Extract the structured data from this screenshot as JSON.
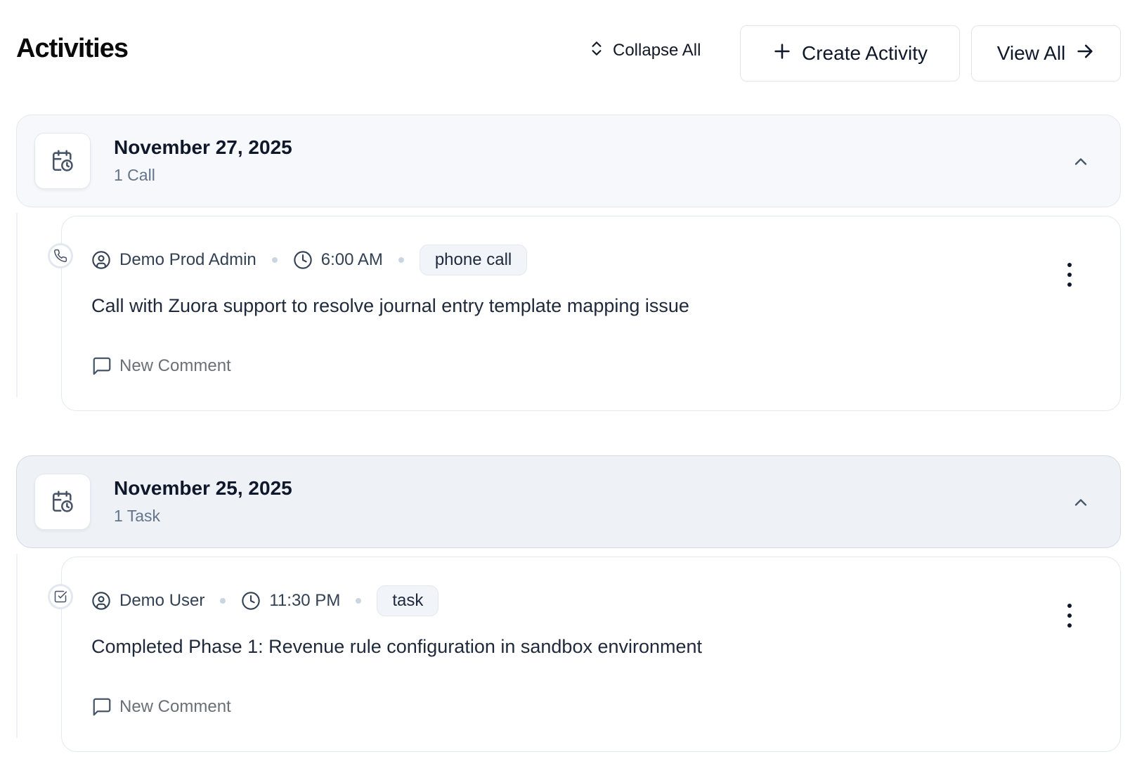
{
  "header": {
    "title": "Activities",
    "collapse_all": "Collapse All",
    "create_activity": "Create Activity",
    "view_all": "View All"
  },
  "groups": [
    {
      "date": "November 27, 2025",
      "count": "1 Call",
      "expanded": true,
      "activities": [
        {
          "type": "phone-call",
          "user": "Demo Prod Admin",
          "time": "6:00 AM",
          "tag": "phone call",
          "description": "Call with Zuora support to resolve journal entry template mapping issue",
          "comment_label": "New Comment"
        }
      ]
    },
    {
      "date": "November 25, 2025",
      "count": "1 Task",
      "expanded": true,
      "activities": [
        {
          "type": "task",
          "user": "Demo User",
          "time": "11:30 PM",
          "tag": "task",
          "description": "Completed Phase 1: Revenue rule configuration in sandbox environment",
          "comment_label": "New Comment"
        }
      ]
    }
  ],
  "colors": {
    "text_primary": "#0f172a",
    "text_muted": "#64748b",
    "border": "#e3e8ef",
    "group_bg": "#f6f8fb"
  }
}
